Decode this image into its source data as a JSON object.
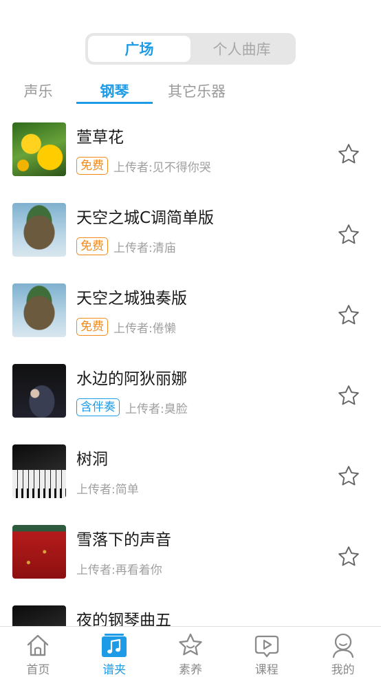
{
  "segments": [
    "广场",
    "个人曲库"
  ],
  "categories": [
    "声乐",
    "钢琴",
    "其它乐器"
  ],
  "songs": [
    {
      "title": "萱草花",
      "badge": "免费",
      "uploader": "上传者:见不得你哭"
    },
    {
      "title": "天空之城C调简单版",
      "badge": "免费",
      "uploader": "上传者:清庙"
    },
    {
      "title": "天空之城独奏版",
      "badge": "免费",
      "uploader": "上传者:倦懒"
    },
    {
      "title": "水边的阿狄丽娜",
      "badge": "含伴奏",
      "uploader": "上传者:臭脸"
    },
    {
      "title": "树洞",
      "badge": "",
      "uploader": "上传者:简单"
    },
    {
      "title": "雪落下的声音",
      "badge": "",
      "uploader": "上传者:再看着你"
    },
    {
      "title": "夜的钢琴曲五",
      "badge": "",
      "uploader": ""
    }
  ],
  "nav": [
    "首页",
    "谱夹",
    "素养",
    "课程",
    "我的"
  ],
  "colors": {
    "accent": "#1e9be6",
    "free_badge": "#f08a1c"
  },
  "icons": {
    "star": "star-outline-icon",
    "nav": [
      "home-icon",
      "music-note-icon",
      "star-face-icon",
      "video-play-icon",
      "person-icon"
    ]
  }
}
